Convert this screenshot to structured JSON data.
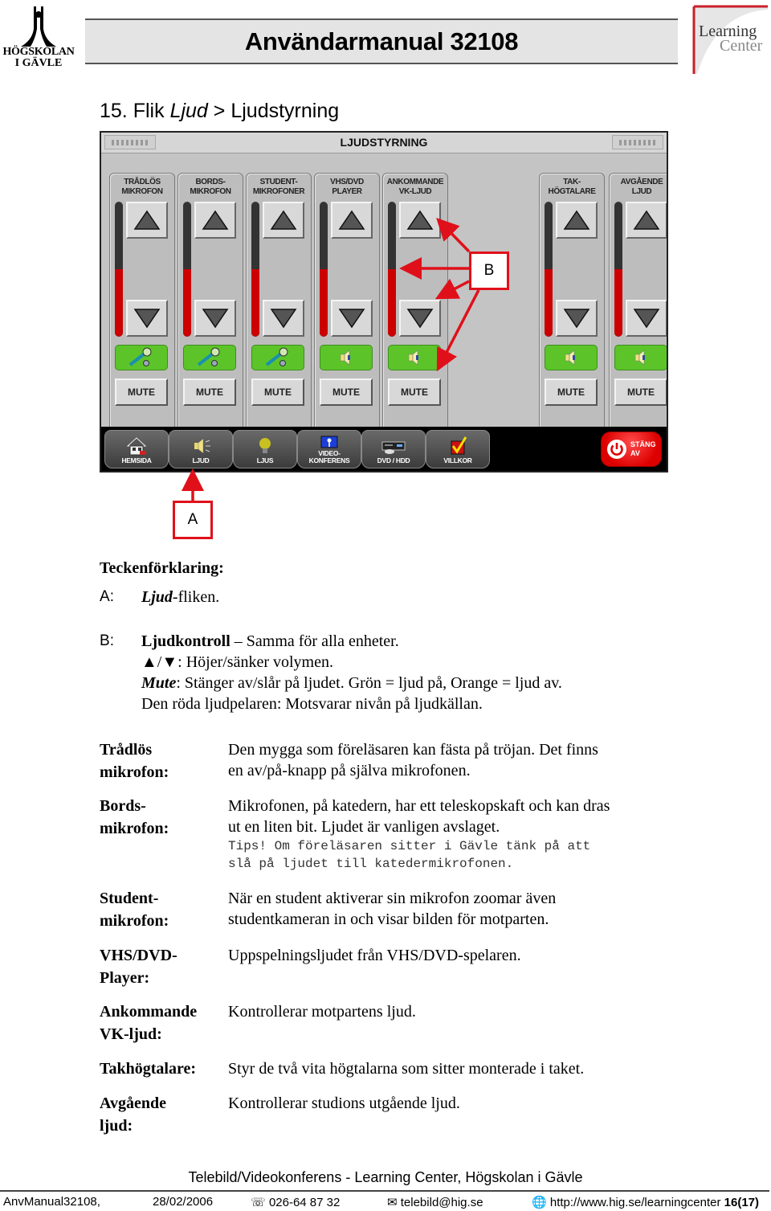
{
  "header": {
    "org_logo": {
      "line1": "HÖGSKOLAN",
      "line2": "I GÄVLE"
    },
    "title": "Användarmanual 32108",
    "brand_logo": {
      "line1": "Learning",
      "line2": "Center"
    }
  },
  "section": {
    "number": "15.",
    "prefix": "Flik",
    "tab_name": "Ljud",
    "separator": ">",
    "name": "Ljudstyrning"
  },
  "screen": {
    "title": "LJUDSTYRNING",
    "channels": [
      {
        "label_1": "TRÅDLÖS",
        "label_2": "MIKROFON",
        "status_icon": "microphone-icon",
        "mute_label": "MUTE",
        "level": 0.5
      },
      {
        "label_1": "BORDS-",
        "label_2": "MIKROFON",
        "status_icon": "microphone-icon",
        "mute_label": "MUTE",
        "level": 0.5
      },
      {
        "label_1": "STUDENT-",
        "label_2": "MIKROFONER",
        "status_icon": "microphone-icon",
        "mute_label": "MUTE",
        "level": 0.5
      },
      {
        "label_1": "VHS/DVD",
        "label_2": "PLAYER",
        "status_icon": "speaker-icon",
        "mute_label": "MUTE",
        "level": 0.5
      },
      {
        "label_1": "ANKOMMANDE",
        "label_2": "VK-LJUD",
        "status_icon": "speaker-icon",
        "mute_label": "MUTE",
        "level": 0.5
      },
      {
        "label_1": "TAK-",
        "label_2": "HÖGTALARE",
        "status_icon": "speaker-icon",
        "mute_label": "MUTE",
        "level": 0.5
      },
      {
        "label_1": "AVGÅENDE",
        "label_2": "LJUD",
        "status_icon": "speaker-icon",
        "mute_label": "MUTE",
        "level": 0.5
      }
    ],
    "tabs": [
      {
        "label": "HEMSIDA",
        "icon": "house-icon"
      },
      {
        "label": "LJUD",
        "icon": "speaker-icon"
      },
      {
        "label": "LJUS",
        "icon": "lightbulb-icon"
      },
      {
        "label": "VIDEO-\nKONFERENS",
        "icon": "video-conference-icon"
      },
      {
        "label": "DVD / HDD",
        "icon": "dvd-player-icon"
      },
      {
        "label": "VILLKOR",
        "icon": "checkmark-icon"
      }
    ],
    "power_button": {
      "line1": "STÄNG",
      "line2": "AV"
    },
    "colors": {
      "status_on": "#5cc429",
      "meter_level": "#cc0000",
      "callout": "#e0101a"
    }
  },
  "callouts": {
    "a": "A",
    "b": "B"
  },
  "legend": {
    "title": "Teckenförklaring:",
    "a_key": "A",
    "a_colon": ":",
    "a_text_italic": "Ljud",
    "a_text_rest": "-fliken.",
    "b_key": "B",
    "b_colon": ":",
    "b_line1_bold": "Ljudkontroll",
    "b_line1_rest": " – Samma för alla enheter.",
    "b_line2_symbols": "▲/▼",
    "b_line2_rest": ": Höjer/sänker volymen.",
    "b_line3_italic": "Mute",
    "b_line3_rest": ": Stänger av/slår på ljudet. Grön = ljud på, Orange = ljud av.",
    "b_line4": "Den röda ljudpelaren: Motsvarar nivån på ljudkällan."
  },
  "definitions": [
    {
      "term_1": "Trådlös",
      "term_2": "mikrofon:",
      "desc_1": "Den mygga som föreläsaren kan fästa på tröjan. Det finns",
      "desc_2": "en av/på-knapp på själva mikrofonen."
    },
    {
      "term_1": "Bords-",
      "term_2": "mikrofon:",
      "desc_1": "Mikrofonen, på katedern, har ett teleskopskaft och kan dras",
      "desc_2": "ut en liten bit. Ljudet är vanligen avslaget.",
      "tip_1": "Tips! Om föreläsaren sitter i Gävle tänk på att",
      "tip_2": "slå på ljudet till katedermikrofonen."
    },
    {
      "term_1": "Student-",
      "term_2": "mikrofon:",
      "desc_1": "När en student aktiverar sin mikrofon zoomar även",
      "desc_2": "studentkameran in och visar bilden för motparten."
    },
    {
      "term_1": "VHS/DVD-",
      "term_2": "Player:",
      "desc_1": "Uppspelningsljudet från VHS/DVD-spelaren."
    },
    {
      "term_1": "Ankommande",
      "term_2": "VK-ljud:",
      "desc_1": "Kontrollerar motpartens ljud."
    },
    {
      "term_1": "Takhögtalare:",
      "desc_1": "Styr de två vita högtalarna som sitter monterade i taket."
    },
    {
      "term_1": "Avgående",
      "term_2": "ljud:",
      "desc_1": "Kontrollerar studions utgående ljud."
    }
  ],
  "footer": {
    "center": "Telebild/Videokonferens - Learning Center, Högskolan i Gävle",
    "doc_id": "AnvManual32108,",
    "date": "28/02/2006",
    "phone": "026-64 87 32",
    "email": "telebild@hig.se",
    "url": "http://www.hig.se/learningcenter",
    "page": "16(17)"
  }
}
